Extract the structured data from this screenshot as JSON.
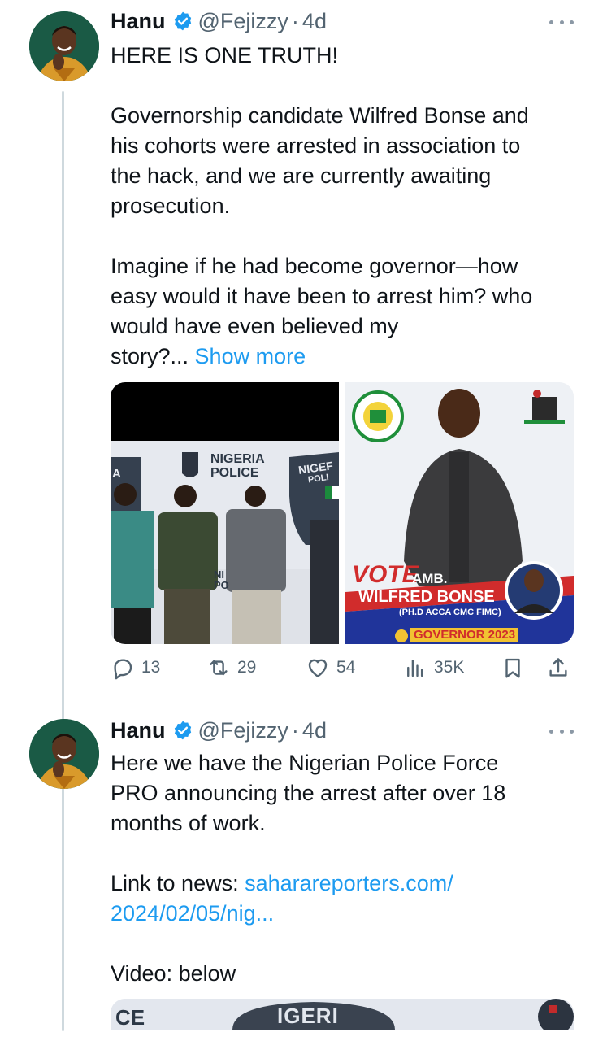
{
  "tweets": [
    {
      "author_name": "Hanu",
      "handle": "@Fejizzy",
      "separator": "·",
      "age": "4d",
      "lines": [
        "HERE IS ONE TRUTH!",
        "",
        "Governorship candidate Wilfred Bonse and",
        "his cohorts were arrested in association to",
        "the hack, and we are currently awaiting",
        "prosecution.",
        "",
        "Imagine if he had become governor—how",
        "easy would it have been to arrest him? who",
        "would have even believed my"
      ],
      "last_line_text": "story?...",
      "show_more": "Show more",
      "media": {
        "left": {
          "sign_line1": "NIGERIA",
          "sign_line2": "POLICE",
          "side_sign1": "NIGEF",
          "side_sign2": "POLI",
          "left_edge": "A",
          "lower_sign1": "NI",
          "lower_sign2": "PO"
        },
        "right": {
          "vote": "VOTE",
          "amb": "AMB.",
          "candidate": "WILFRED BONSE",
          "credentials": "(PH.D ACCA CMC FIMC)",
          "office": "GOVERNOR 2023"
        }
      },
      "stats": {
        "replies": "13",
        "retweets": "29",
        "likes": "54",
        "views": "35K"
      }
    },
    {
      "author_name": "Hanu",
      "handle": "@Fejizzy",
      "separator": "·",
      "age": "4d",
      "lines": [
        "Here we have the Nigerian Police Force",
        "PRO announcing the arrest after over 18",
        "months of work.",
        ""
      ],
      "link_label": "Link to news: ",
      "link_part1": "saharareporters.com/",
      "link_part2": "2024/02/05/nig...",
      "video_label": "Video: below",
      "media_preview": {
        "left_text": "CE",
        "center_text": "IGERI"
      }
    }
  ],
  "colors": {
    "link": "#1d9bf0",
    "verified": "#1d9bf0",
    "text": "#0f1419",
    "muted": "#536471",
    "thread_line": "#cfd9de"
  }
}
